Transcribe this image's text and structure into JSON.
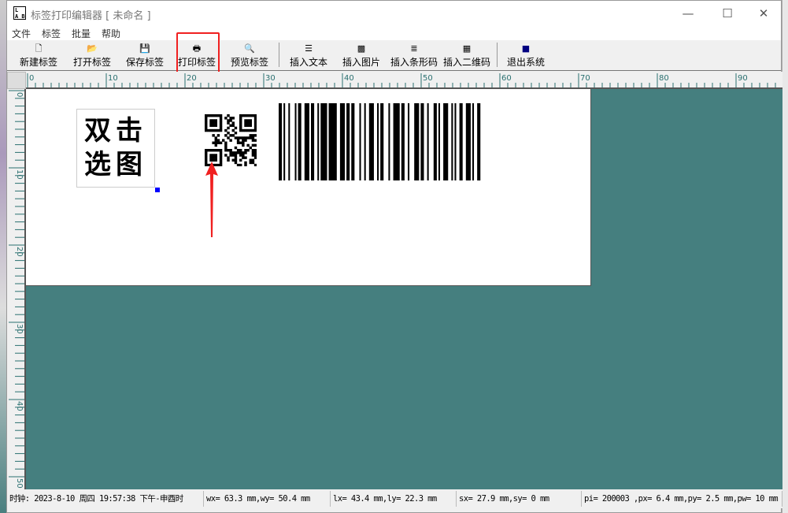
{
  "window": {
    "title": "标签打印编辑器 [ 未命名 ]",
    "icon_text": "L A B",
    "controls": {
      "minimize": "—",
      "maximize": "☐",
      "close": "✕"
    }
  },
  "menu": [
    "文件",
    "标签",
    "批量",
    "帮助"
  ],
  "toolbar": [
    {
      "label": "新建标签",
      "icon": "new-file-icon",
      "glyph": "🗋"
    },
    {
      "label": "打开标签",
      "icon": "open-folder-icon",
      "glyph": "📂"
    },
    {
      "label": "保存标签",
      "icon": "save-disk-icon",
      "glyph": "💾"
    },
    {
      "label": "打印标签",
      "icon": "printer-icon",
      "glyph": "🖶"
    },
    {
      "label": "预览标签",
      "icon": "preview-icon",
      "glyph": "🔍"
    },
    {
      "label": "插入文本",
      "icon": "text-icon",
      "glyph": "☰"
    },
    {
      "label": "插入图片",
      "icon": "picture-icon",
      "glyph": "▩"
    },
    {
      "label": "插入条形码",
      "icon": "barcode-icon",
      "glyph": "≣"
    },
    {
      "label": "插入二维码",
      "icon": "qrcode-icon",
      "glyph": "▦"
    },
    {
      "label": "退出系统",
      "icon": "exit-icon",
      "glyph": "■"
    }
  ],
  "ruler": {
    "h_labels": [
      "0",
      "10",
      "20",
      "30",
      "40",
      "50",
      "60",
      "70",
      "80",
      "90"
    ],
    "v_labels": [
      "0",
      "10",
      "20",
      "30",
      "40",
      "50"
    ]
  },
  "label": {
    "image_placeholder": [
      "双击",
      "选图"
    ]
  },
  "status": {
    "clock": "时钟: 2023-8-10 周四 19:57:38 下午-申酉时",
    "window_size": "wx= 63.3 mm,wy= 50.4 mm",
    "label_size": "lx= 43.4 mm,ly= 22.3 mm",
    "selection": "sx= 27.9 mm,sy= 0 mm",
    "printer": "pi= 200003 ,px= 6.4 mm,py= 2.5 mm,pw= 10 mm"
  },
  "colors": {
    "canvas": "#457f7f",
    "ruler_text": "#2a7070",
    "highlight": "#f02020",
    "handle": "#0000ff"
  }
}
